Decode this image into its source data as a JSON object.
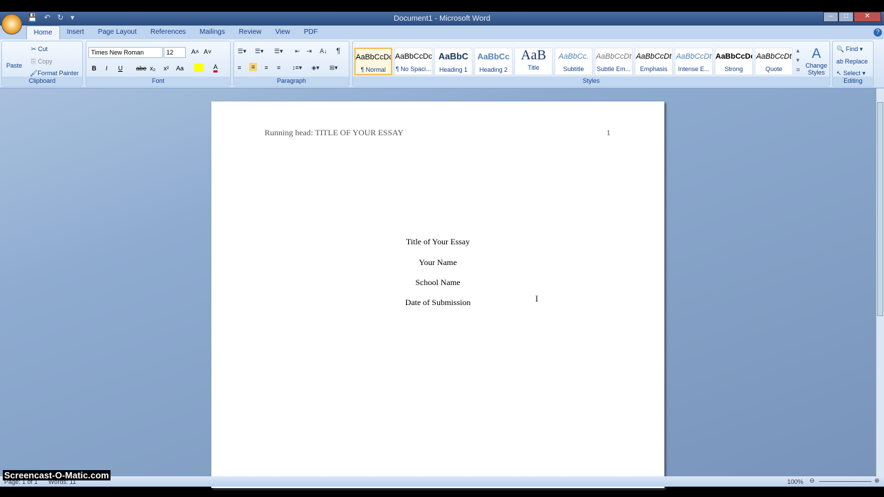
{
  "window": {
    "title": "Document1 - Microsoft Word"
  },
  "qat": {
    "save": "💾",
    "undo": "↶",
    "redo": "↻",
    "more": "▾"
  },
  "tabs": [
    "Home",
    "Insert",
    "Page Layout",
    "References",
    "Mailings",
    "Review",
    "View",
    "PDF"
  ],
  "clipboard": {
    "paste": "Paste",
    "cut": "Cut",
    "copy": "Copy",
    "format_painter": "Format Painter",
    "label": "Clipboard"
  },
  "font": {
    "name": "Times New Roman",
    "size": "12",
    "bold": "B",
    "italic": "I",
    "underline": "U",
    "strike": "abe",
    "sub": "x₂",
    "sup": "x²",
    "case": "Aa",
    "grow": "A˄",
    "shrink": "A˅",
    "label": "Font"
  },
  "paragraph": {
    "label": "Paragraph",
    "pilcrow": "¶",
    "sort": "A↓"
  },
  "styles": {
    "label": "Styles",
    "items": [
      {
        "sample": "AaBbCcDc",
        "name": "¶ Normal"
      },
      {
        "sample": "AaBbCcDc",
        "name": "¶ No Spaci..."
      },
      {
        "sample": "AaBbC",
        "name": "Heading 1"
      },
      {
        "sample": "AaBbCc",
        "name": "Heading 2"
      },
      {
        "sample": "AaB",
        "name": "Title"
      },
      {
        "sample": "AaBbCc.",
        "name": "Subtitle"
      },
      {
        "sample": "AaBbCcDt",
        "name": "Subtle Em..."
      },
      {
        "sample": "AaBbCcDt",
        "name": "Emphasis"
      },
      {
        "sample": "AaBbCcDt",
        "name": "Intense E..."
      },
      {
        "sample": "AaBbCcDc",
        "name": "Strong"
      },
      {
        "sample": "AaBbCcDt",
        "name": "Quote"
      }
    ],
    "change": "Change Styles"
  },
  "editing": {
    "find": "Find",
    "replace": "Replace",
    "select": "Select",
    "label": "Editing"
  },
  "document": {
    "header": "Running head: TITLE OF YOUR ESSAY",
    "page_number": "1",
    "lines": [
      "Title of Your Essay",
      "Your Name",
      "School Name",
      "Date of Submission"
    ]
  },
  "status": {
    "page": "Page: 1 of 1",
    "words": "Words: 11",
    "zoom": "100%"
  },
  "watermark": "Screencast-O-Matic.com"
}
